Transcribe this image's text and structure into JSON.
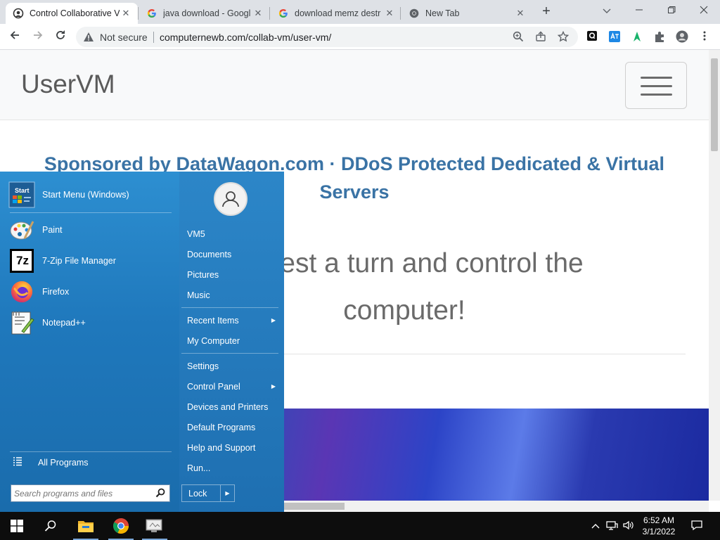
{
  "browser": {
    "tabs": [
      {
        "title": "Control Collaborative V",
        "active": true
      },
      {
        "title": "java download - Googl",
        "active": false
      },
      {
        "title": "download memz destr",
        "active": false
      },
      {
        "title": "New Tab",
        "active": false
      }
    ],
    "security_label": "Not secure",
    "url": "computernewb.com/collab-vm/user-vm/"
  },
  "page": {
    "brand": "UserVM",
    "sponsor_line1": "Sponsored by DataWagon.com · DDoS Protected Dedicated & Virtual",
    "sponsor_line2": "Servers",
    "hero_line1": "request a turn and control the",
    "hero_line2": "computer!"
  },
  "start_menu": {
    "pinned": [
      {
        "label": "Start Menu (Windows)",
        "icon": "start-menu-app-icon"
      },
      {
        "label": "Paint",
        "icon": "paint-icon"
      },
      {
        "label": "7-Zip File Manager",
        "icon": "7zip-icon"
      },
      {
        "label": "Firefox",
        "icon": "firefox-icon"
      },
      {
        "label": "Notepad++",
        "icon": "notepadpp-icon"
      }
    ],
    "start_icon_text": "Start",
    "zip_icon_text": "7z",
    "all_programs": "All Programs",
    "search_placeholder": "Search programs and files",
    "right_items": {
      "user": "VM5",
      "documents": "Documents",
      "pictures": "Pictures",
      "music": "Music",
      "recent_items": "Recent Items",
      "my_computer": "My Computer",
      "settings": "Settings",
      "control_panel": "Control Panel",
      "devices_printers": "Devices and Printers",
      "default_programs": "Default Programs",
      "help_support": "Help and Support",
      "run": "Run..."
    },
    "lock": "Lock"
  },
  "taskbar": {
    "time": "6:52 AM",
    "date": "3/1/2022"
  }
}
